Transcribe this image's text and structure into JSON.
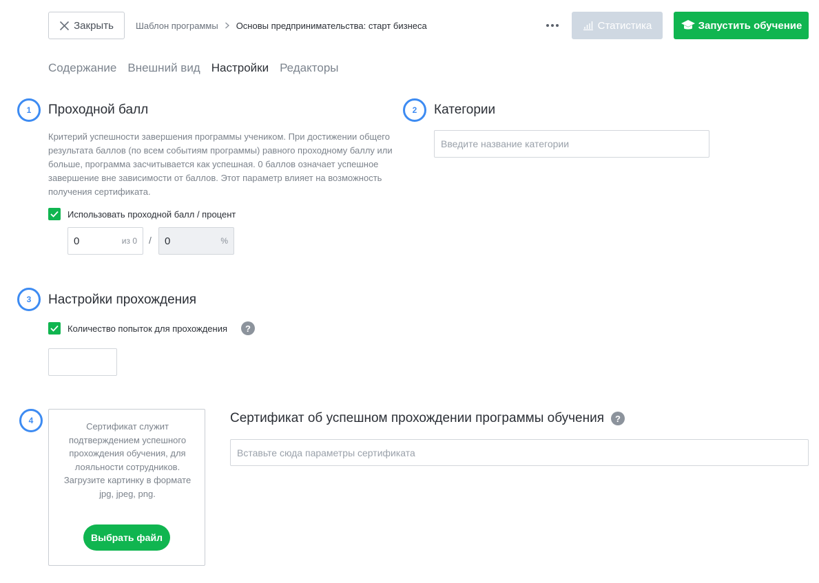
{
  "header": {
    "close_label": "Закрыть",
    "breadcrumb": {
      "parent": "Шаблон программы",
      "current": "Основы предпринимательства: старт бизнеса"
    },
    "stats_label": "Статистика",
    "launch_label": "Запустить обучение"
  },
  "tabs": [
    {
      "label": "Содержание",
      "active": false
    },
    {
      "label": "Внешний вид",
      "active": false
    },
    {
      "label": "Настройки",
      "active": true
    },
    {
      "label": "Редакторы",
      "active": false
    }
  ],
  "sections": {
    "passing_score": {
      "number": "1",
      "title": "Проходной балл",
      "description": "Критерий успешности завершения программы учеником. При достижении общего результата баллов (по всем событиям программы) равного проходному баллу или больше, программа засчитывается как успешная. 0 баллов означает успешное завершение вне зависимости от баллов. Этот параметр влияет на возможность получения сертификата.",
      "checkbox_label": "Использовать проходной балл / процент",
      "checked": true,
      "score_value": "0",
      "score_suffix": "из 0",
      "separator": "/",
      "percent_value": "0",
      "percent_suffix": "%"
    },
    "categories": {
      "number": "2",
      "title": "Категории",
      "placeholder": "Введите название категории"
    },
    "completion": {
      "number": "3",
      "title": "Настройки прохождения",
      "checkbox_label": "Количество попыток для прохождения",
      "checked": true,
      "attempts_value": "",
      "help": "?"
    },
    "certificate": {
      "number": "4",
      "upload_text": "Сертификат служит подтверждением успешного прохождения обучения, для лояльности сотрудников. Загрузите картинку в формате jpg, jpeg, png.",
      "choose_file_label": "Выбрать файл",
      "title": "Сертификат об успешном прохождении программы обучения",
      "help": "?",
      "placeholder": "Вставьте сюда параметры сертификата"
    }
  },
  "colors": {
    "accent_green": "#10b550",
    "step_blue": "#3d8bf2",
    "disabled_button": "#cfd8e2"
  }
}
